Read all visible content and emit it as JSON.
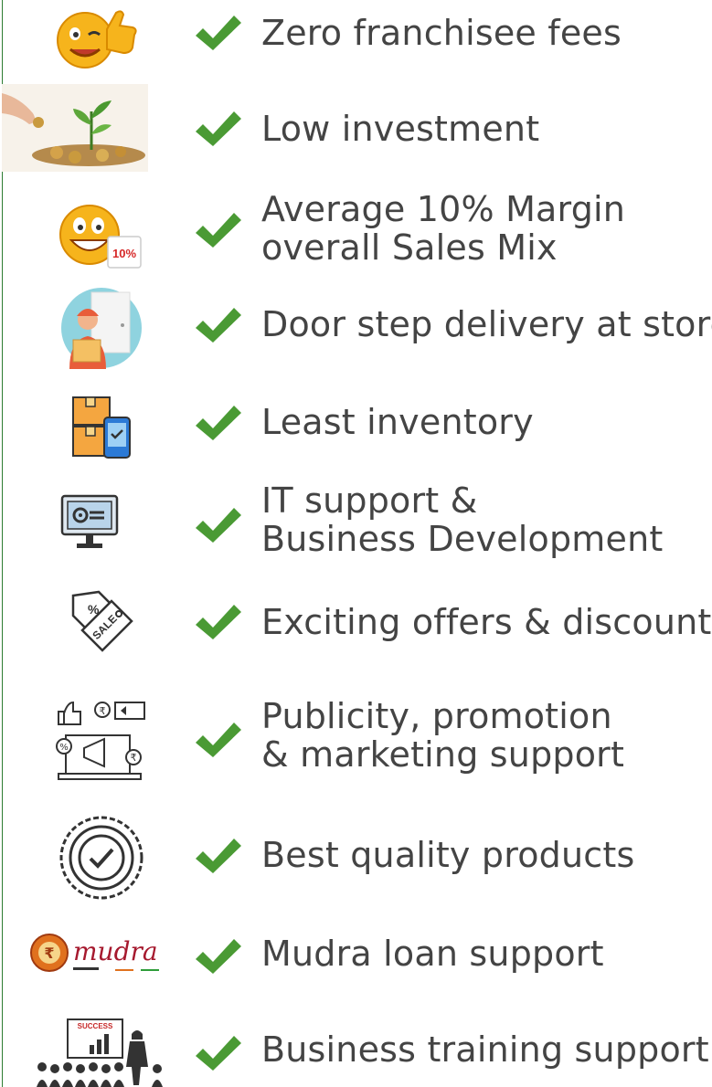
{
  "colors": {
    "check": "#4a9a34",
    "text": "#444444",
    "rule": "#2e7d32"
  },
  "benefits": [
    {
      "icon": "winking-smiley-thumbs-up-icon",
      "lines": [
        "Zero franchisee fees"
      ]
    },
    {
      "icon": "money-plant-coins-icon",
      "lines": [
        "Low investment"
      ]
    },
    {
      "icon": "smiley-discount-tag-icon",
      "tag": "10%",
      "lines": [
        "Average 10% Margin",
        "overall Sales Mix"
      ]
    },
    {
      "icon": "delivery-person-door-icon",
      "lines": [
        "Door step delivery at store"
      ]
    },
    {
      "icon": "inventory-boxes-phone-icon",
      "lines": [
        "Least inventory"
      ]
    },
    {
      "icon": "computer-settings-icon",
      "lines": [
        "IT support &",
        "Business Development"
      ]
    },
    {
      "icon": "sale-tag-icon",
      "tag": "SALE",
      "lines": [
        "Exciting offers & discounts"
      ]
    },
    {
      "icon": "marketing-megaphone-laptop-icon",
      "lines": [
        "Publicity, promotion",
        "& marketing support"
      ]
    },
    {
      "icon": "quality-check-seal-icon",
      "lines": [
        "Best quality products"
      ]
    },
    {
      "icon": "mudra-logo-icon",
      "lines": [
        "Mudra loan support"
      ]
    },
    {
      "icon": "business-training-presentation-icon",
      "tag": "SUCCESS",
      "lines": [
        "Business training support"
      ]
    }
  ]
}
